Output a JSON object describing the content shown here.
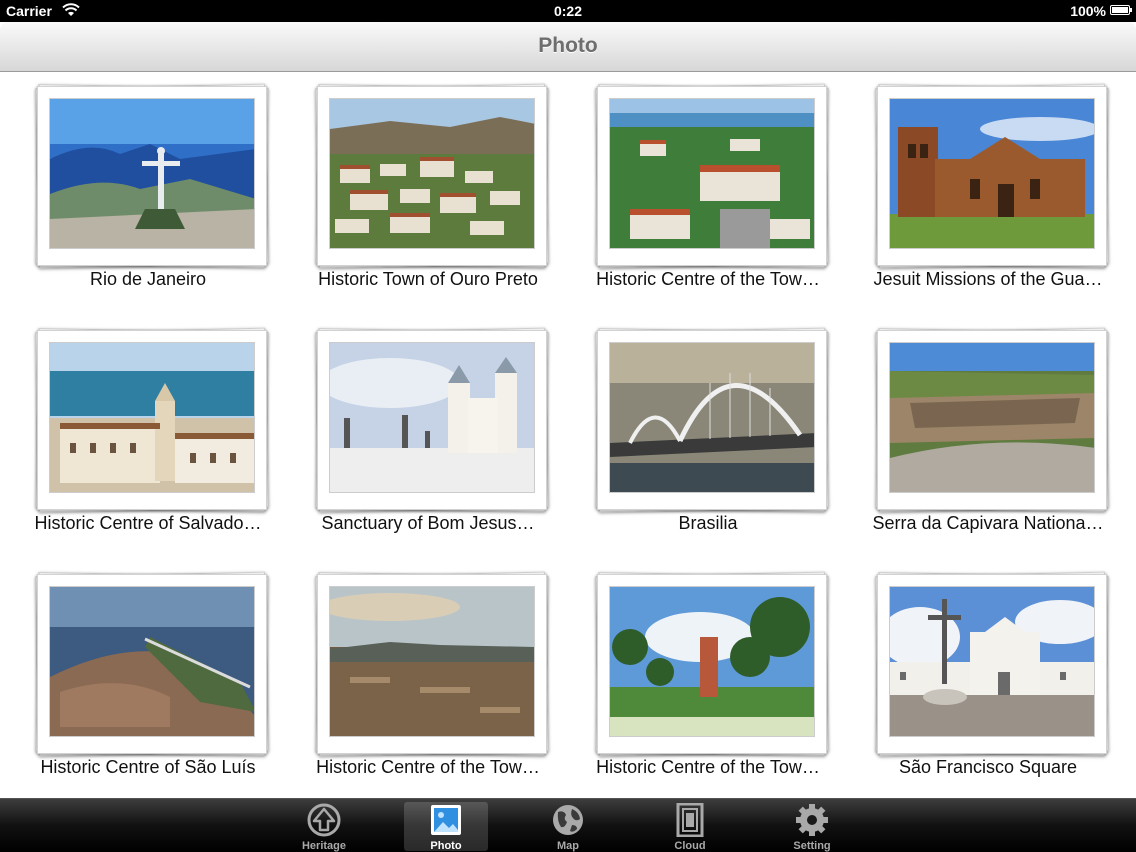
{
  "status": {
    "carrier": "Carrier",
    "time": "0:22",
    "battery": "100%"
  },
  "nav": {
    "title": "Photo"
  },
  "photos": [
    {
      "caption": "Rio de Janeiro"
    },
    {
      "caption": "Historic Town of Ouro Preto"
    },
    {
      "caption": "Historic Centre of the Tow…"
    },
    {
      "caption": "Jesuit Missions of the Gua…"
    },
    {
      "caption": "Historic Centre of Salvado…"
    },
    {
      "caption": "Sanctuary of Bom Jesus…"
    },
    {
      "caption": "Brasilia"
    },
    {
      "caption": "Serra da Capivara Nationa…"
    },
    {
      "caption": "Historic Centre of São Luís"
    },
    {
      "caption": "Historic Centre of the Tow…"
    },
    {
      "caption": "Historic Centre of the Tow…"
    },
    {
      "caption": "São Francisco Square"
    }
  ],
  "tabs": [
    {
      "label": "Heritage",
      "icon": "heritage-icon",
      "active": false
    },
    {
      "label": "Photo",
      "icon": "photo-icon",
      "active": true
    },
    {
      "label": "Map",
      "icon": "globe-icon",
      "active": false
    },
    {
      "label": "Cloud",
      "icon": "cloud-icon",
      "active": false
    },
    {
      "label": "Setting",
      "icon": "gear-icon",
      "active": false
    }
  ],
  "colors": {
    "tab_active": "#ffffff",
    "tab_inactive": "#a9a9a9",
    "nav_title": "#6e6e6e"
  }
}
